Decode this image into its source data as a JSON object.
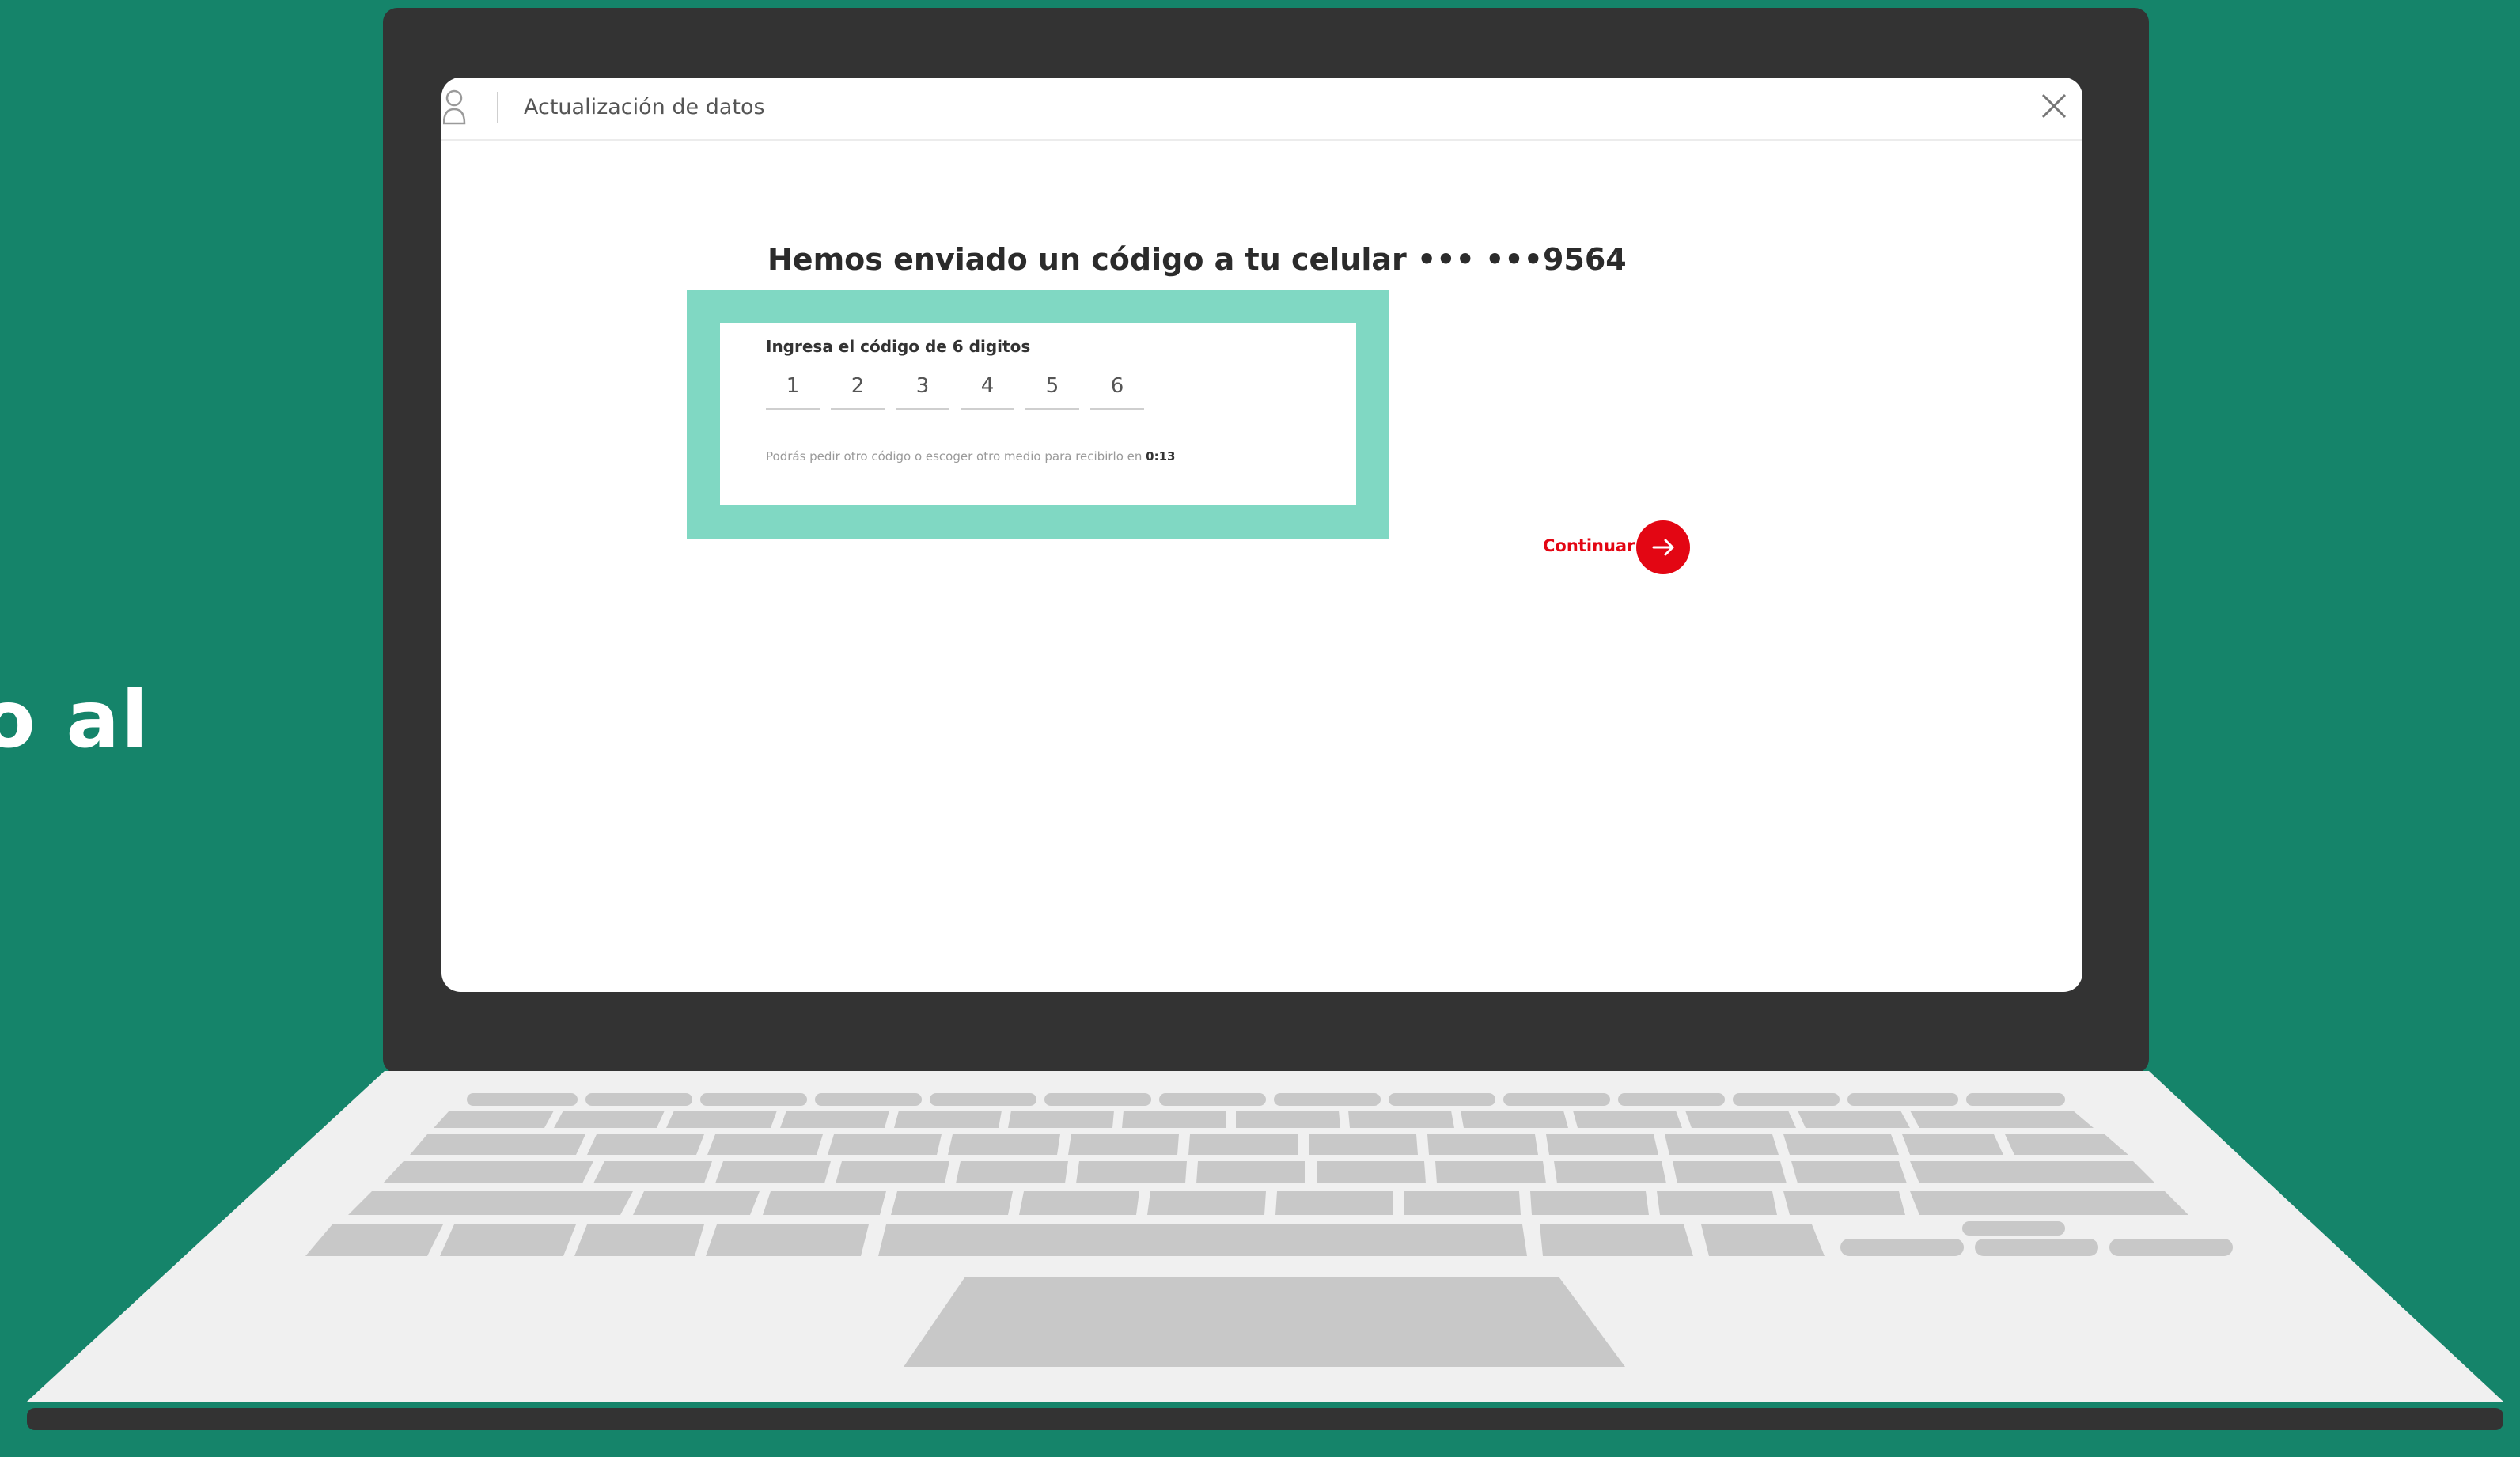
{
  "side_text": "o al",
  "screen": {
    "header": {
      "title": "Actualización de datos",
      "user_icon": "user-icon",
      "close_icon": "close-icon"
    },
    "headline": "Hemos enviado un código a tu celular ••• •••9564",
    "code_form": {
      "label": "Ingresa el código de 6 digitos",
      "digits": [
        "1",
        "2",
        "3",
        "4",
        "5",
        "6"
      ],
      "resend_text": "Podrás pedir otro código o escoger otro medio para recibirlo en",
      "resend_timer": "0:13"
    },
    "continue": {
      "label": "Continuar",
      "icon": "arrow-right-icon"
    }
  },
  "colors": {
    "background": "#15846a",
    "highlight": "#80d8c3",
    "accent": "#e30613",
    "laptop_lid": "#333333",
    "keyboard_deck": "#f0f0f0",
    "keys": "#c8c8c8"
  }
}
